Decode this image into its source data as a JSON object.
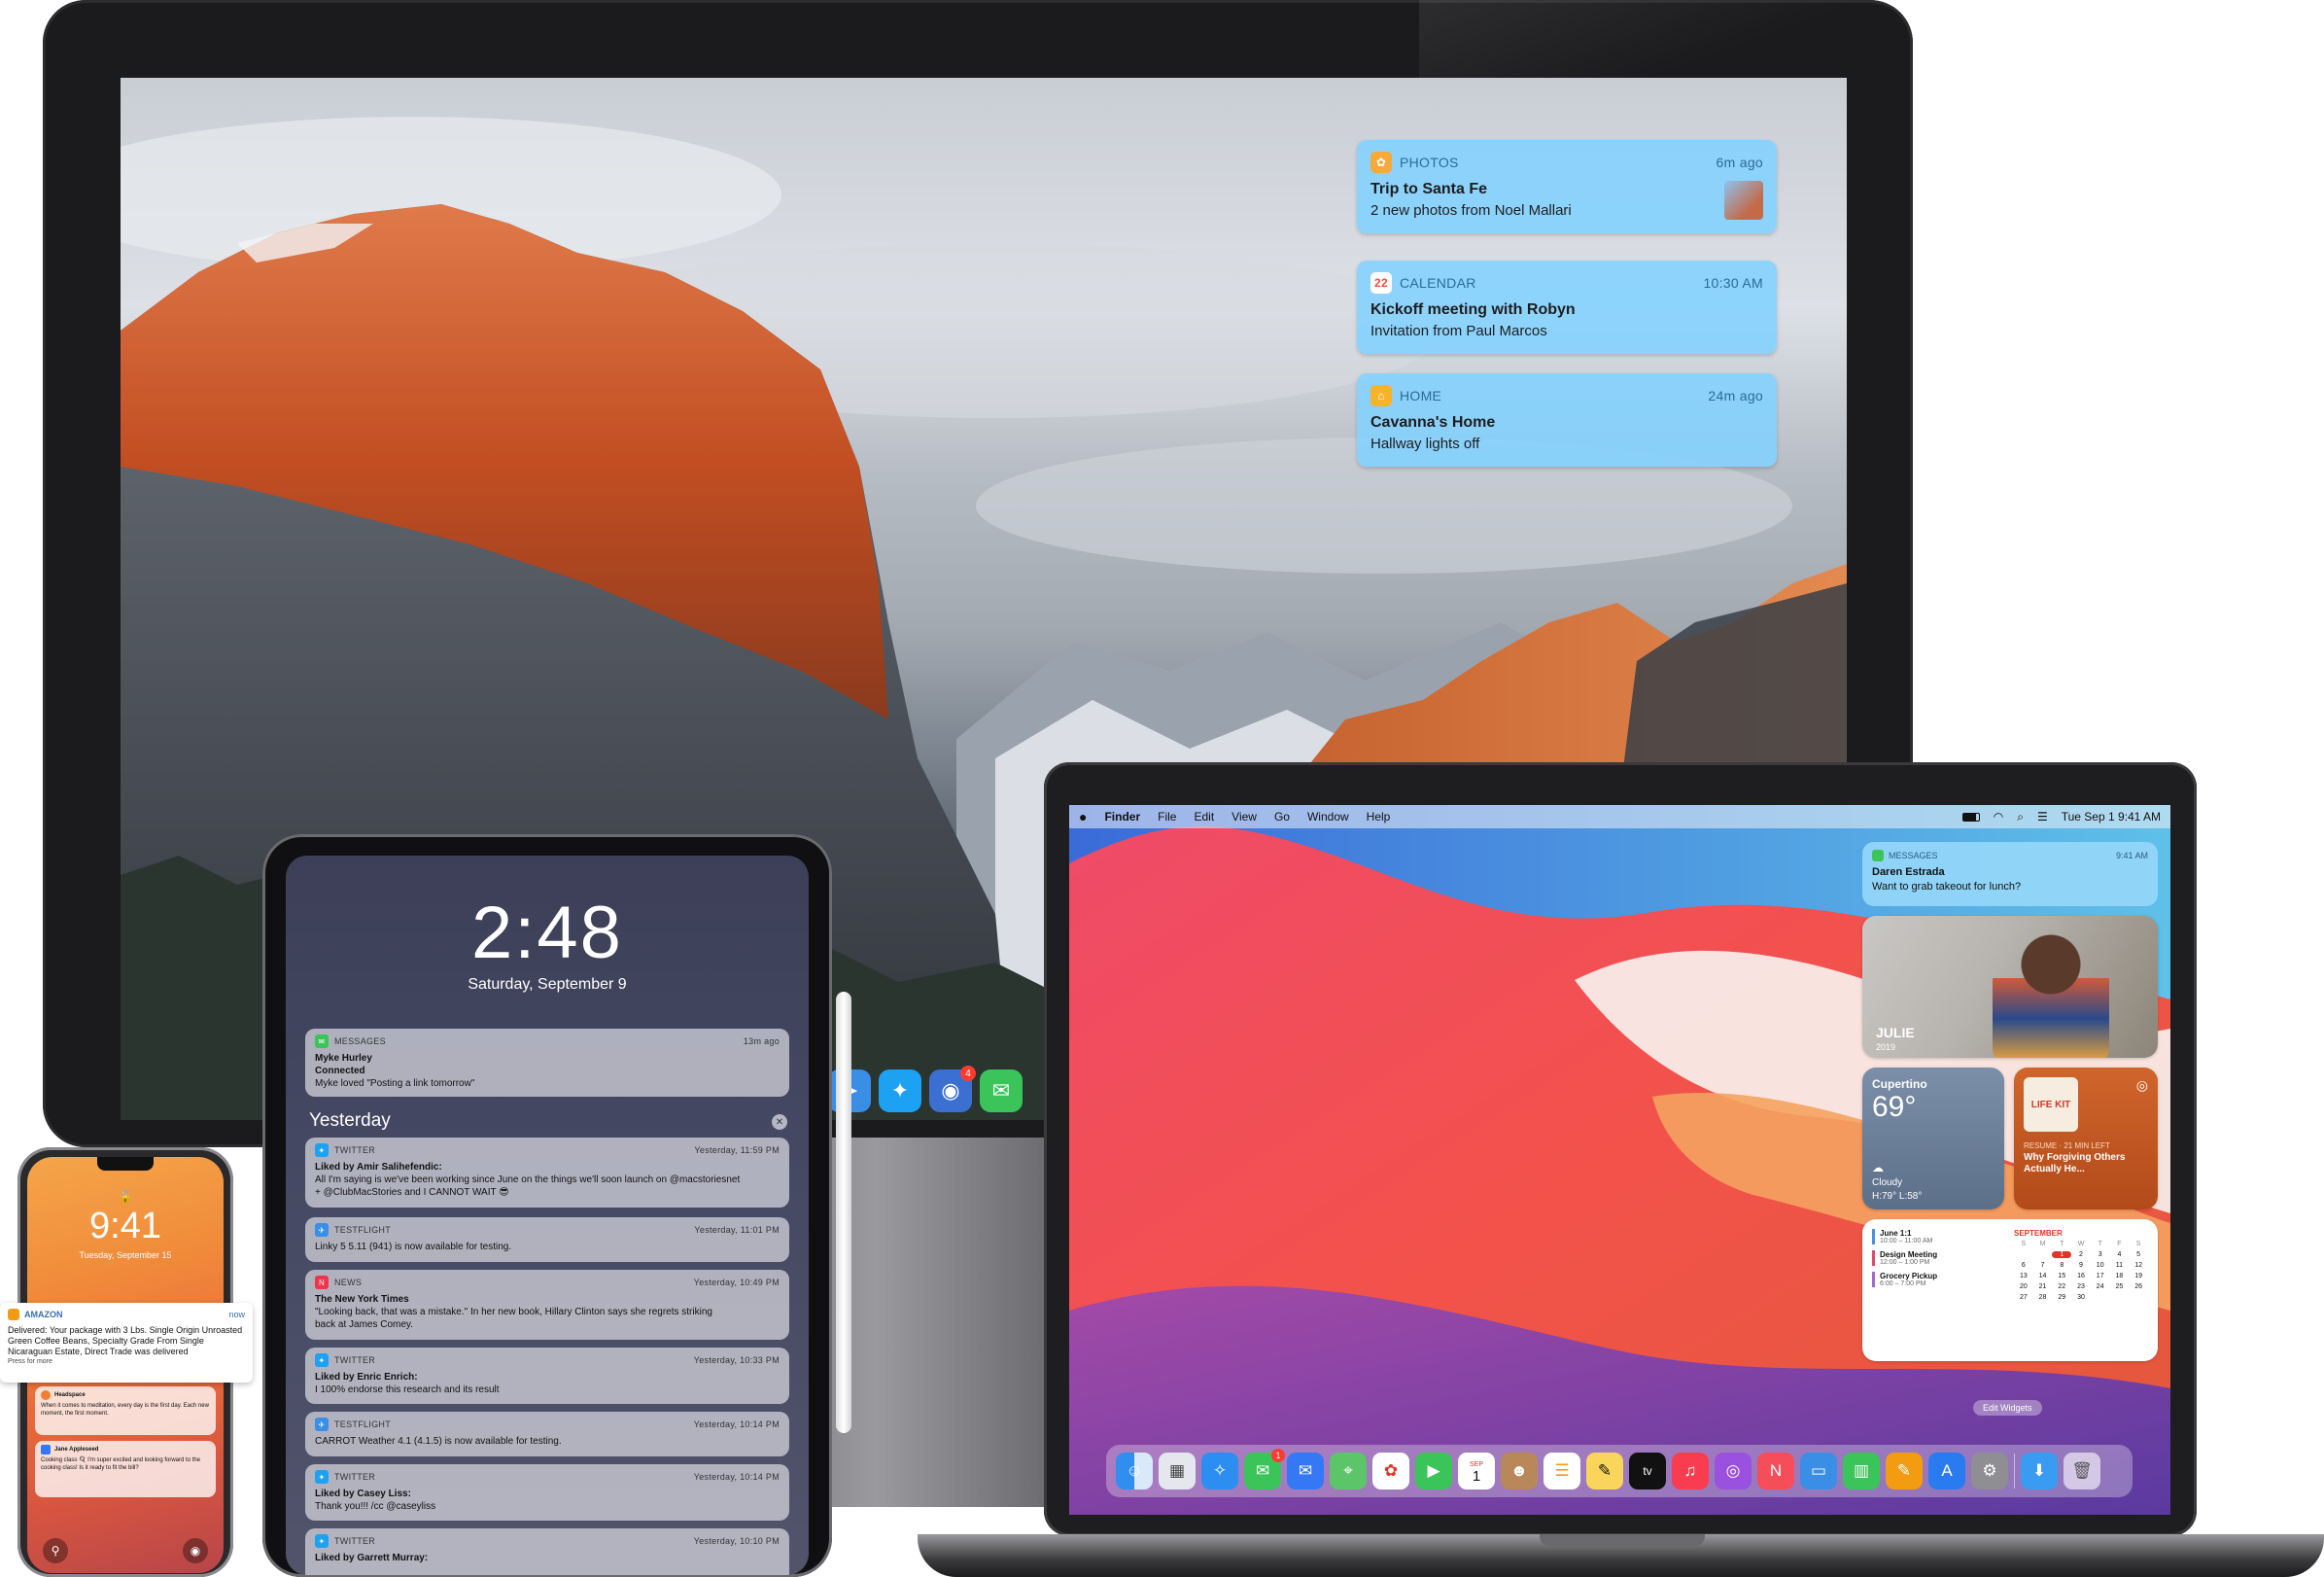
{
  "imac": {
    "notifications": [
      {
        "app": "PHOTOS",
        "time": "6m ago",
        "title": "Trip to Santa Fe",
        "body": "2 new photos from Noel Mallari",
        "color": "#f7a93a"
      },
      {
        "app": "CALENDAR",
        "time": "10:30 AM",
        "title": "Kickoff meeting with Robyn",
        "body": "Invitation from Paul Marcos",
        "color": "#ff4b3e",
        "icon_text": "22"
      },
      {
        "app": "HOME",
        "time": "24m ago",
        "title": "Cavanna's Home",
        "body": "Hallway lights off",
        "color": "#f7b32b"
      }
    ],
    "dock_badge": "4"
  },
  "macbook": {
    "menubar": {
      "apple": "",
      "app": "Finder",
      "menus": [
        "File",
        "Edit",
        "View",
        "Go",
        "Window",
        "Help"
      ],
      "clock": "Tue Sep 1  9:41 AM"
    },
    "message": {
      "app": "MESSAGES",
      "time": "9:41 AM",
      "sender": "Daren Estrada",
      "text": "Want to grab takeout for lunch?"
    },
    "photo_widget": {
      "name": "JULIE",
      "year": "2019"
    },
    "weather": {
      "city": "Cupertino",
      "temp": "69°",
      "condition": "Cloudy",
      "range": "H:79° L:58°"
    },
    "podcast": {
      "status": "RESUME · 21 MIN LEFT",
      "title": "Why Forgiving Others Actually He..."
    },
    "calendar": {
      "events": [
        {
          "title": "June 1:1",
          "time": "10:00 – 11:00 AM",
          "color": "#4a90e2"
        },
        {
          "title": "Design Meeting",
          "time": "12:00 – 1:00 PM",
          "color": "#e04a6a"
        },
        {
          "title": "Grocery Pickup",
          "time": "6:00 – 7:00 PM",
          "color": "#a06ad0"
        }
      ],
      "month": "SEPTEMBER",
      "weekdays": [
        "S",
        "M",
        "T",
        "W",
        "T",
        "F",
        "S"
      ],
      "weeks": [
        [
          "",
          "",
          "1",
          "2",
          "3",
          "4",
          "5"
        ],
        [
          "6",
          "7",
          "8",
          "9",
          "10",
          "11",
          "12"
        ],
        [
          "13",
          "14",
          "15",
          "16",
          "17",
          "18",
          "19"
        ],
        [
          "20",
          "21",
          "22",
          "23",
          "24",
          "25",
          "26"
        ],
        [
          "27",
          "28",
          "29",
          "30",
          "",
          "",
          ""
        ]
      ],
      "today": "1"
    },
    "edit_widgets": "Edit Widgets",
    "dock_calendar_day": "1",
    "dock_calendar_month": "SEP",
    "dock_messages_badge": "1",
    "dock_tv": "tv"
  },
  "ipad": {
    "time": "2:48",
    "date": "Saturday, September 9",
    "notifications": [
      {
        "app": "MESSAGES",
        "time": "13m ago",
        "title": "Myke Hurley",
        "lines": [
          "Connected",
          "Myke loved \"Posting a link tomorrow\""
        ],
        "color": "#3bc45a"
      }
    ],
    "section": "Yesterday",
    "older": [
      {
        "app": "TWITTER",
        "time": "Yesterday, 11:59 PM",
        "title": "Liked by Amir Salihefendic:",
        "lines": [
          "All I'm saying is we've been working since June on the things we'll soon launch on @macstoriesnet",
          "+ @ClubMacStories and I CANNOT WAIT 😎"
        ],
        "color": "#1da1f2"
      },
      {
        "app": "TESTFLIGHT",
        "time": "Yesterday, 11:01 PM",
        "title": "",
        "lines": [
          "Linky 5 5.11 (941) is now available for testing."
        ],
        "color": "#3a8ee6"
      },
      {
        "app": "NEWS",
        "time": "Yesterday, 10:49 PM",
        "title": "The New York Times",
        "lines": [
          "\"Looking back, that was a mistake.\" In her new book, Hillary Clinton says she regrets striking",
          "back at James Comey."
        ],
        "color": "#f0344a"
      },
      {
        "app": "TWITTER",
        "time": "Yesterday, 10:33 PM",
        "title": "Liked by Enric Enrich:",
        "lines": [
          "I 100% endorse this research and its result"
        ],
        "color": "#1da1f2"
      },
      {
        "app": "TESTFLIGHT",
        "time": "Yesterday, 10:14 PM",
        "title": "",
        "lines": [
          "CARROT Weather 4.1 (4.1.5) is now available for testing."
        ],
        "color": "#3a8ee6"
      },
      {
        "app": "TWITTER",
        "time": "Yesterday, 10:14 PM",
        "title": "Liked by Casey Liss:",
        "lines": [
          "Thank you!!! /cc @caseyliss"
        ],
        "color": "#1da1f2"
      },
      {
        "app": "TWITTER",
        "time": "Yesterday, 10:10 PM",
        "title": "Liked by Garrett Murray:",
        "lines": [],
        "color": "#1da1f2"
      }
    ]
  },
  "iphone": {
    "time": "9:41",
    "date": "Tuesday, September 15",
    "amazon": {
      "app": "AMAZON",
      "time": "now",
      "text": "Delivered: Your package with 3 Lbs. Single Origin Unroasted Green Coffee Beans, Specialty Grade From Single Nicaraguan Estate, Direct Trade was delivered",
      "hint": "Press for more"
    },
    "notes": [
      {
        "app": "Headspace",
        "time": "",
        "text": "When it comes to meditation, every day is the first day. Each new moment, the first moment.",
        "color": "#f47d31"
      },
      {
        "app": "Jane Appleseed",
        "time": "",
        "text": "Cooking class 🍳 I'm super excited and looking forward to the cooking class! Is it ready to fit the bill?",
        "color": "#3478f6"
      }
    ]
  }
}
